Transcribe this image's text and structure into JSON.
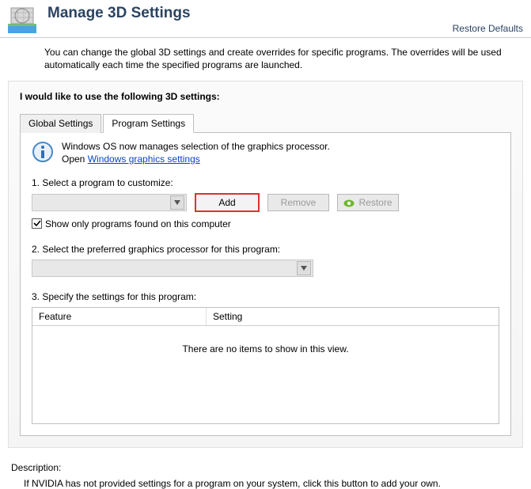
{
  "header": {
    "title": "Manage 3D Settings",
    "restore_defaults": "Restore Defaults"
  },
  "intro": "You can change the global 3D settings and create overrides for specific programs. The overrides will be used automatically each time the specified programs are launched.",
  "section_label": "I would like to use the following 3D settings:",
  "tabs": {
    "global": "Global Settings",
    "program": "Program Settings"
  },
  "info": {
    "line1": "Windows OS now manages selection of the graphics processor.",
    "line2_prefix": "Open ",
    "link": "Windows graphics settings"
  },
  "step1": {
    "label": "1. Select a program to customize:",
    "add": "Add",
    "remove": "Remove",
    "restore": "Restore",
    "checkbox": "Show only programs found on this computer"
  },
  "step2": {
    "label": "2. Select the preferred graphics processor for this program:"
  },
  "step3": {
    "label": "3. Specify the settings for this program:",
    "col_feature": "Feature",
    "col_setting": "Setting",
    "empty": "There are no items to show in this view."
  },
  "description": {
    "title": "Description:",
    "body": "If NVIDIA has not provided settings for a program on your system, click this button to add your own."
  }
}
